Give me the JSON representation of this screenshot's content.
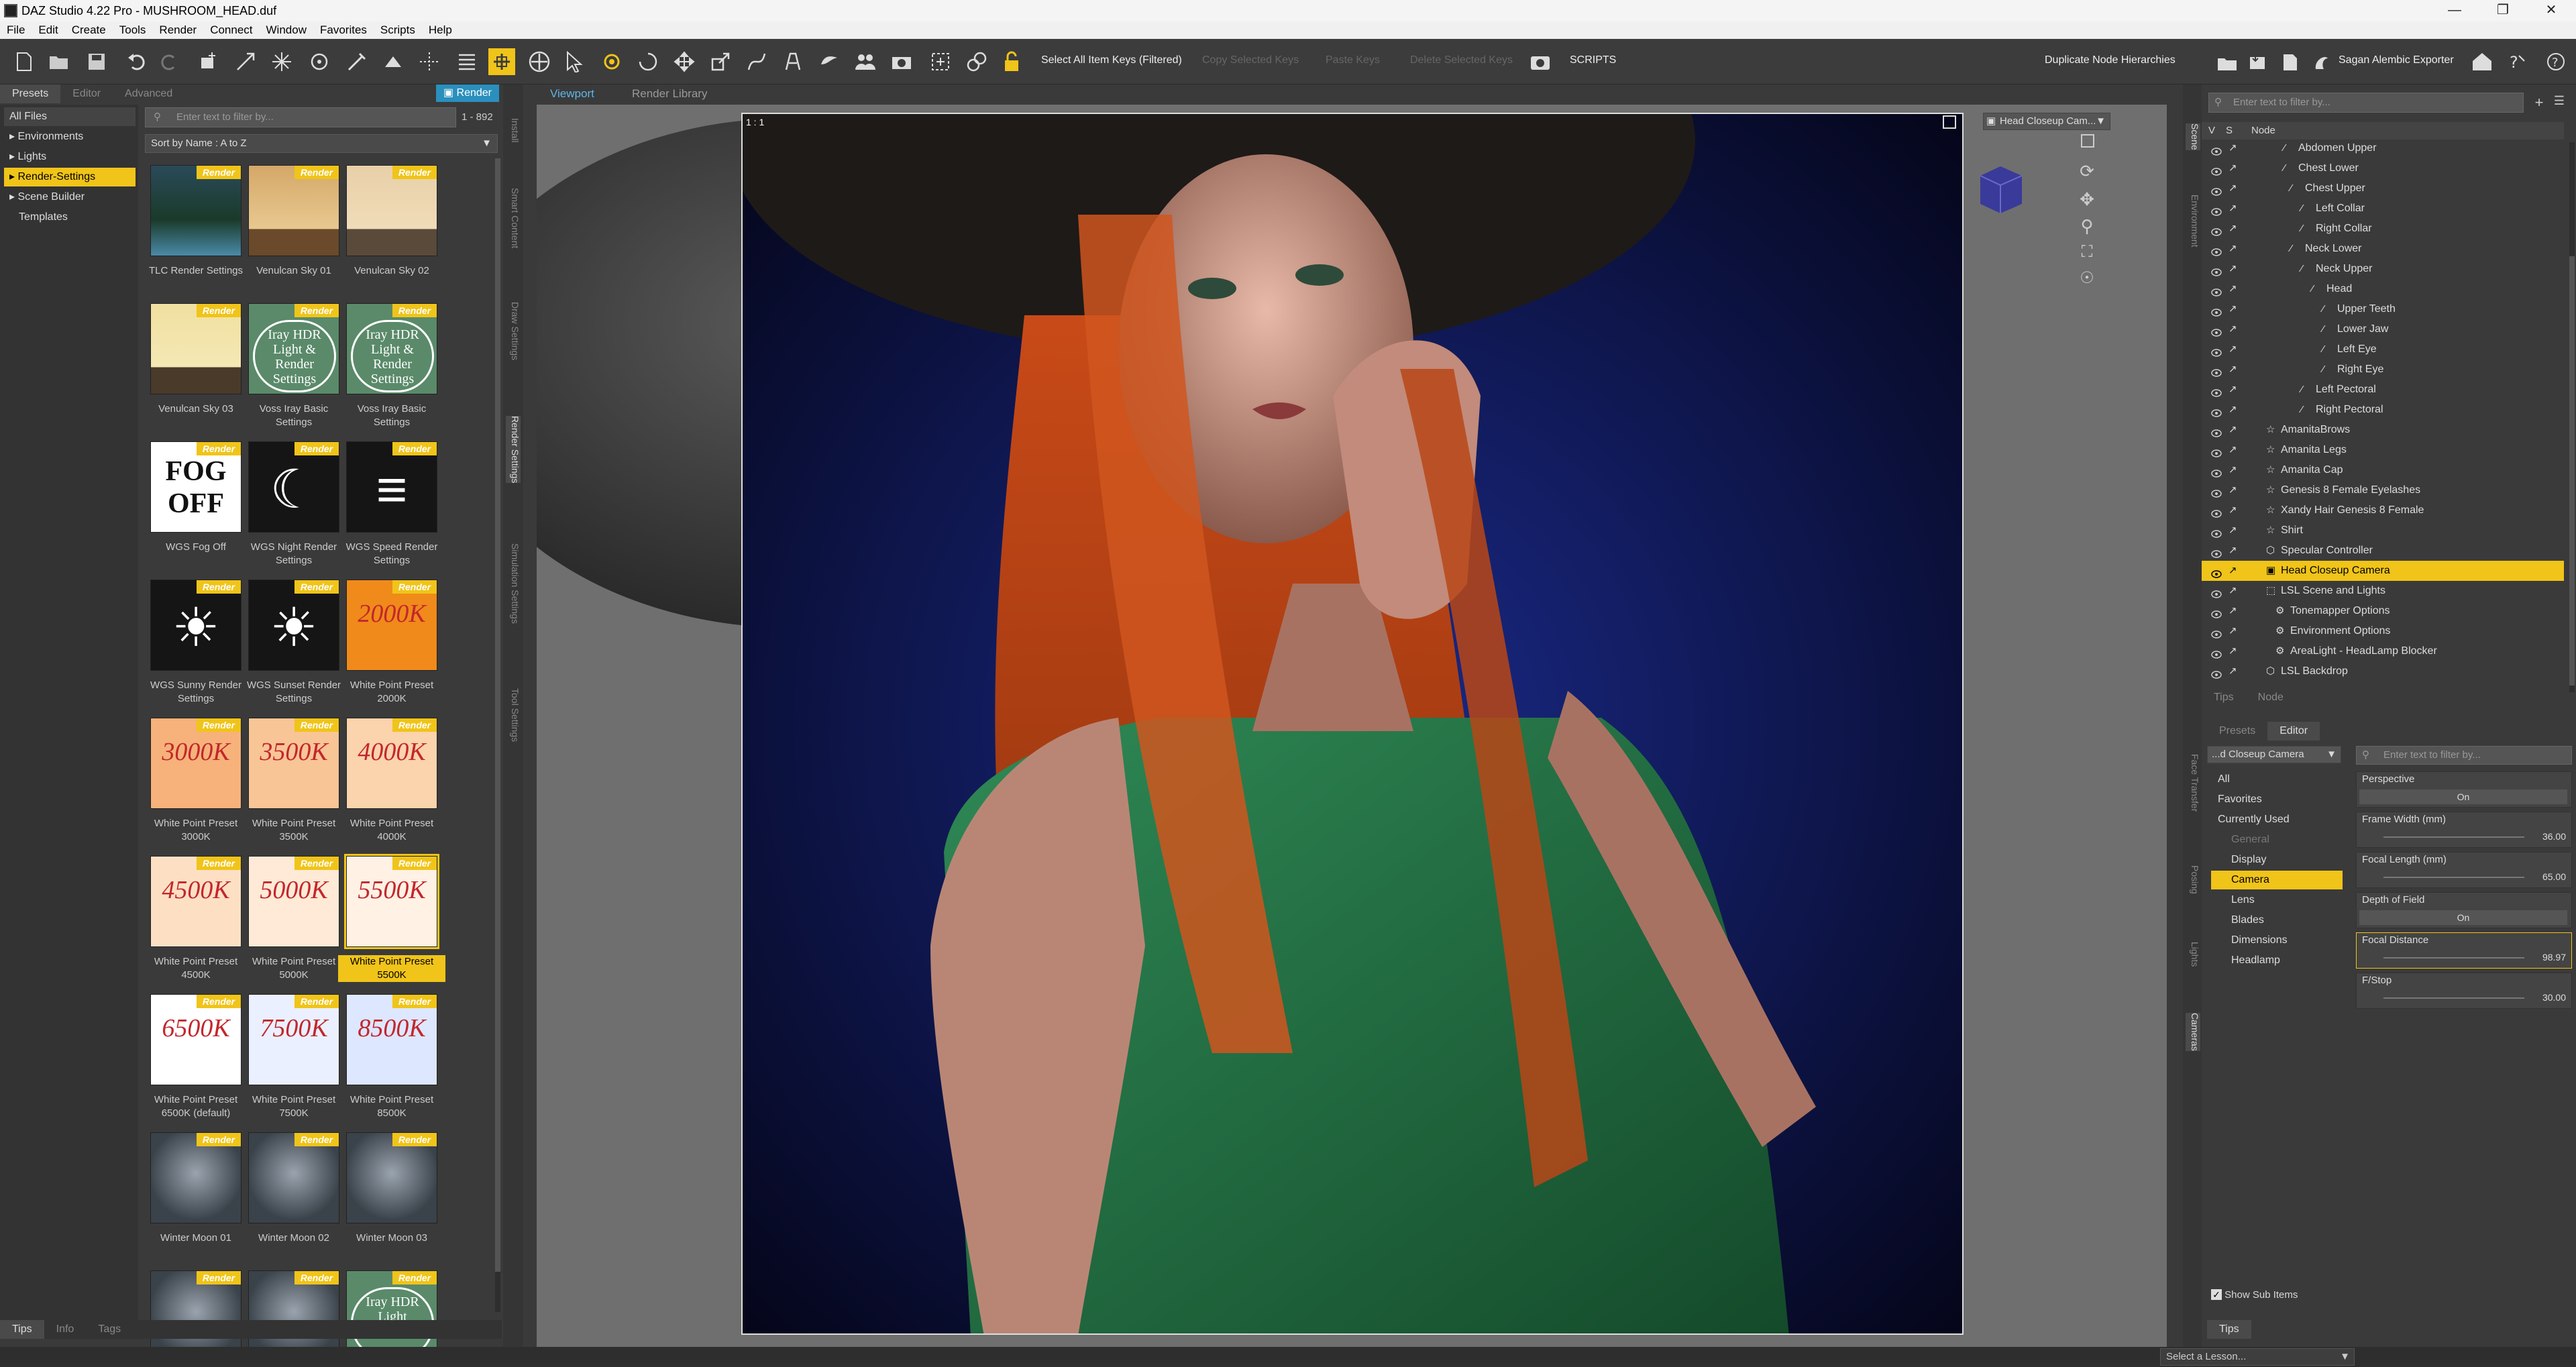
{
  "window": {
    "title": "DAZ Studio 4.22 Pro - MUSHROOM_HEAD.duf"
  },
  "menu": [
    "File",
    "Edit",
    "Create",
    "Tools",
    "Render",
    "Connect",
    "Window",
    "Favorites",
    "Scripts",
    "Help"
  ],
  "toolbar": {
    "select_keys": "Select All Item Keys (Filtered)",
    "copy_keys": "Copy Selected Keys",
    "paste_keys": "Paste Keys",
    "delete_keys": "Delete Selected Keys",
    "scripts": "SCRIPTS",
    "duplicate": "Duplicate Node Hierarchies",
    "alembic": "Sagan Alembic Exporter"
  },
  "left_panel": {
    "tabs": [
      "Presets",
      "Editor",
      "Advanced"
    ],
    "render_button": "Render",
    "categories": [
      "All Files",
      "Environments",
      "Lights",
      "Render-Settings",
      "Scene Builder",
      "Templates"
    ],
    "selected_category": "Render-Settings",
    "filter_placeholder": "Enter text to filter by...",
    "count": "1 - 892",
    "sort": "Sort by Name : A to Z",
    "badge": "Render",
    "items": [
      {
        "label": "TLC Render Settings",
        "thumb": "pool"
      },
      {
        "label": "Venulcan Sky 01",
        "thumb": "sky1"
      },
      {
        "label": "Venulcan Sky 02",
        "thumb": "sky2"
      },
      {
        "label": "Venulcan Sky 03",
        "thumb": "sky3"
      },
      {
        "label": "Voss Iray Basic Settings",
        "thumb": "hdr",
        "text": "Iray HDR Light & Render Settings"
      },
      {
        "label": "Voss Iray Basic Settings",
        "thumb": "hdr",
        "text": "Iray HDR Light & Render Settings"
      },
      {
        "label": "WGS Fog Off",
        "thumb": "fog",
        "text": "FOG OFF"
      },
      {
        "label": "WGS Night Render Settings",
        "thumb": "night"
      },
      {
        "label": "WGS Speed Render Settings",
        "thumb": "speed"
      },
      {
        "label": "WGS Sunny Render Settings",
        "thumb": "sun"
      },
      {
        "label": "WGS Sunset Render Settings",
        "thumb": "sunset"
      },
      {
        "label": "White Point Preset 2000K",
        "thumb": "wp",
        "text": "2000K",
        "bg": "#f08a1a"
      },
      {
        "label": "White Point Preset 3000K",
        "thumb": "wp",
        "text": "3000K",
        "bg": "#f6b27a"
      },
      {
        "label": "White Point Preset 3500K",
        "thumb": "wp",
        "text": "3500K",
        "bg": "#f8c596"
      },
      {
        "label": "White Point Preset 4000K",
        "thumb": "wp",
        "text": "4000K",
        "bg": "#fbd3ac"
      },
      {
        "label": "White Point Preset 4500K",
        "thumb": "wp",
        "text": "4500K",
        "bg": "#fde0c4"
      },
      {
        "label": "White Point Preset 5000K",
        "thumb": "wp",
        "text": "5000K",
        "bg": "#feead6"
      },
      {
        "label": "White Point Preset 5500K",
        "thumb": "wp",
        "text": "5500K",
        "bg": "#fff1e4",
        "selected": true
      },
      {
        "label": "White Point Preset 6500K (default)",
        "thumb": "wp",
        "text": "6500K",
        "bg": "#ffffff"
      },
      {
        "label": "White Point Preset 7500K",
        "thumb": "wp",
        "text": "7500K",
        "bg": "#eaf0ff"
      },
      {
        "label": "White Point Preset 8500K",
        "thumb": "wp",
        "text": "8500K",
        "bg": "#dde7ff"
      },
      {
        "label": "Winter Moon 01",
        "thumb": "moon"
      },
      {
        "label": "Winter Moon 02",
        "thumb": "moon"
      },
      {
        "label": "Winter Moon 03",
        "thumb": "moon"
      },
      {
        "label": "",
        "thumb": "moon"
      },
      {
        "label": "",
        "thumb": "moon"
      },
      {
        "label": "",
        "thumb": "hdr",
        "text": "Iray HDR Light"
      }
    ],
    "bottom_tabs": [
      "Tips",
      "Info",
      "Tags"
    ]
  },
  "side_tabs_left": [
    "Install",
    "Smart Content",
    "Draw Settings",
    "Render Settings",
    "Simulation Settings",
    "Tool Settings"
  ],
  "viewport": {
    "tabs": [
      "Viewport",
      "Render Library"
    ],
    "active_tab": "Viewport",
    "ratio": "1 : 1",
    "camera": "Head Closeup Cam..."
  },
  "scene": {
    "filter_placeholder": "Enter text to filter by...",
    "header_v": "V",
    "header_s": "S",
    "header_node": "Node",
    "nodes": [
      {
        "label": "Abdomen Upper",
        "type": "bone"
      },
      {
        "label": "Chest Lower",
        "type": "bone"
      },
      {
        "label": "Chest Upper",
        "type": "bone"
      },
      {
        "label": "Left Collar",
        "type": "bone"
      },
      {
        "label": "Right Collar",
        "type": "bone"
      },
      {
        "label": "Neck Lower",
        "type": "bone"
      },
      {
        "label": "Neck Upper",
        "type": "bone"
      },
      {
        "label": "Head",
        "type": "bone"
      },
      {
        "label": "Upper Teeth",
        "type": "bone"
      },
      {
        "label": "Lower Jaw",
        "type": "bone"
      },
      {
        "label": "Left Eye",
        "type": "bone"
      },
      {
        "label": "Right Eye",
        "type": "bone"
      },
      {
        "label": "Left Pectoral",
        "type": "bone"
      },
      {
        "label": "Right Pectoral",
        "type": "bone"
      },
      {
        "label": "AmanitaBrows",
        "type": "figure"
      },
      {
        "label": "Amanita Legs",
        "type": "figure"
      },
      {
        "label": "Amanita Cap",
        "type": "figure"
      },
      {
        "label": "Genesis 8 Female Eyelashes",
        "type": "figure"
      },
      {
        "label": "Xandy Hair Genesis 8 Female",
        "type": "figure"
      },
      {
        "label": "Shirt",
        "type": "figure"
      },
      {
        "label": "Specular Controller",
        "type": "prop"
      },
      {
        "label": "Head Closeup Camera",
        "type": "camera",
        "selected": true
      },
      {
        "label": "LSL Scene and Lights",
        "type": "group"
      },
      {
        "label": "Tonemapper Options",
        "type": "option"
      },
      {
        "label": "Environment Options",
        "type": "option"
      },
      {
        "label": "AreaLight - HeadLamp Blocker",
        "type": "option"
      },
      {
        "label": "LSL Backdrop",
        "type": "prop"
      }
    ],
    "tabs": [
      "Tips",
      "Node"
    ]
  },
  "side_tabs_right": [
    "Scene",
    "Environment"
  ],
  "side_tabs_right2": [
    "Face Transfer",
    "Posing",
    "Lights",
    "Cameras"
  ],
  "params": {
    "tabs": [
      "Presets",
      "Editor"
    ],
    "node_dropdown": "...d Closeup Camera",
    "filter_placeholder": "Enter text to filter by...",
    "groups": [
      "All",
      "Favorites",
      "Currently Used",
      "General",
      "Display",
      "Camera",
      "Lens",
      "Blades",
      "Dimensions",
      "Headlamp"
    ],
    "selected_group": "Camera",
    "properties": [
      {
        "name": "Perspective",
        "value": "On",
        "kind": "toggle"
      },
      {
        "name": "Frame Width (mm)",
        "value": "36.00",
        "kind": "slider"
      },
      {
        "name": "Focal Length (mm)",
        "value": "65.00",
        "kind": "slider"
      },
      {
        "name": "Depth of Field",
        "value": "On",
        "kind": "toggle"
      },
      {
        "name": "Focal Distance",
        "value": "98.97",
        "kind": "slider"
      },
      {
        "name": "F/Stop",
        "value": "30.00",
        "kind": "slider"
      }
    ],
    "show_sub_items": "Show Sub Items",
    "tips_tab": "Tips"
  },
  "status": {
    "lesson": "Select a Lesson..."
  }
}
